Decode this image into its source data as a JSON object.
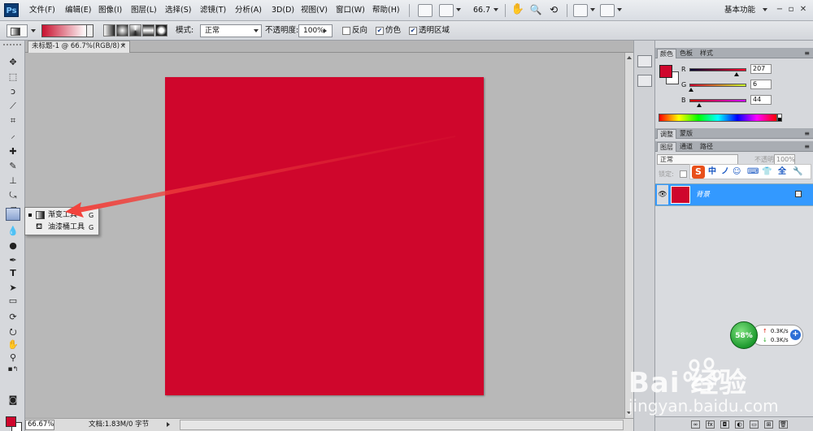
{
  "app": {
    "logo": "Ps",
    "menu": [
      "文件(F)",
      "编辑(E)",
      "图像(I)",
      "图层(L)",
      "选择(S)",
      "滤镜(T)",
      "分析(A)",
      "3D(D)",
      "视图(V)",
      "窗口(W)",
      "帮助(H)"
    ],
    "zoom_readout": "66.7",
    "workspace": "基本功能",
    "win_minimize": "−",
    "win_restore": "▫",
    "win_close": "✕"
  },
  "options": {
    "mode_label": "模式:",
    "mode_value": "正常",
    "opacity_label": "不透明度:",
    "opacity_value": "100%",
    "reverse_label": "反向",
    "reverse_checked": false,
    "dither_label": "仿色",
    "dither_checked": true,
    "transparency_label": "透明区域",
    "transparency_checked": true
  },
  "document": {
    "tab_title": "未标题-1 @ 66.7%(RGB/8) *",
    "tab_close": "×",
    "canvas_color": "#cf062c",
    "zoom": "66.67%",
    "info": "文档:1.83M/0 字节"
  },
  "flyout": {
    "items": [
      {
        "label": "渐变工具",
        "key": "G",
        "icon": "gradient-icon",
        "selected": true
      },
      {
        "label": "油漆桶工具",
        "key": "G",
        "icon": "paint-bucket-icon",
        "selected": false
      }
    ]
  },
  "tools": {
    "foreground": "#cf062c",
    "background": "#ffffff"
  },
  "panels": {
    "color_tabs": [
      "颜色",
      "色板",
      "样式"
    ],
    "adjust_tabs": [
      "调整",
      "蒙版"
    ],
    "layer_tabs": [
      "图层",
      "通道",
      "路径"
    ],
    "channels": [
      {
        "label": "R",
        "value": "207"
      },
      {
        "label": "G",
        "value": "6"
      },
      {
        "label": "B",
        "value": "44"
      }
    ],
    "layers": {
      "blend_mode": "正常",
      "opacity_label": "不透明度:",
      "opacity_value": "100%",
      "lock_label": "锁定:",
      "items": [
        {
          "name": "背景",
          "visible": true,
          "locked": true
        }
      ]
    },
    "ime": {
      "logo": "S",
      "icons": [
        "中",
        "ノ",
        "☺",
        "⌨",
        "👕",
        "全",
        "🔧"
      ]
    }
  },
  "net": {
    "percent": "58%",
    "up": "0.3K/s",
    "down": "0.3K/s",
    "plus": "+"
  },
  "watermark": {
    "brand": "Bai  经验",
    "sub": "jingyan.baidu.com"
  }
}
